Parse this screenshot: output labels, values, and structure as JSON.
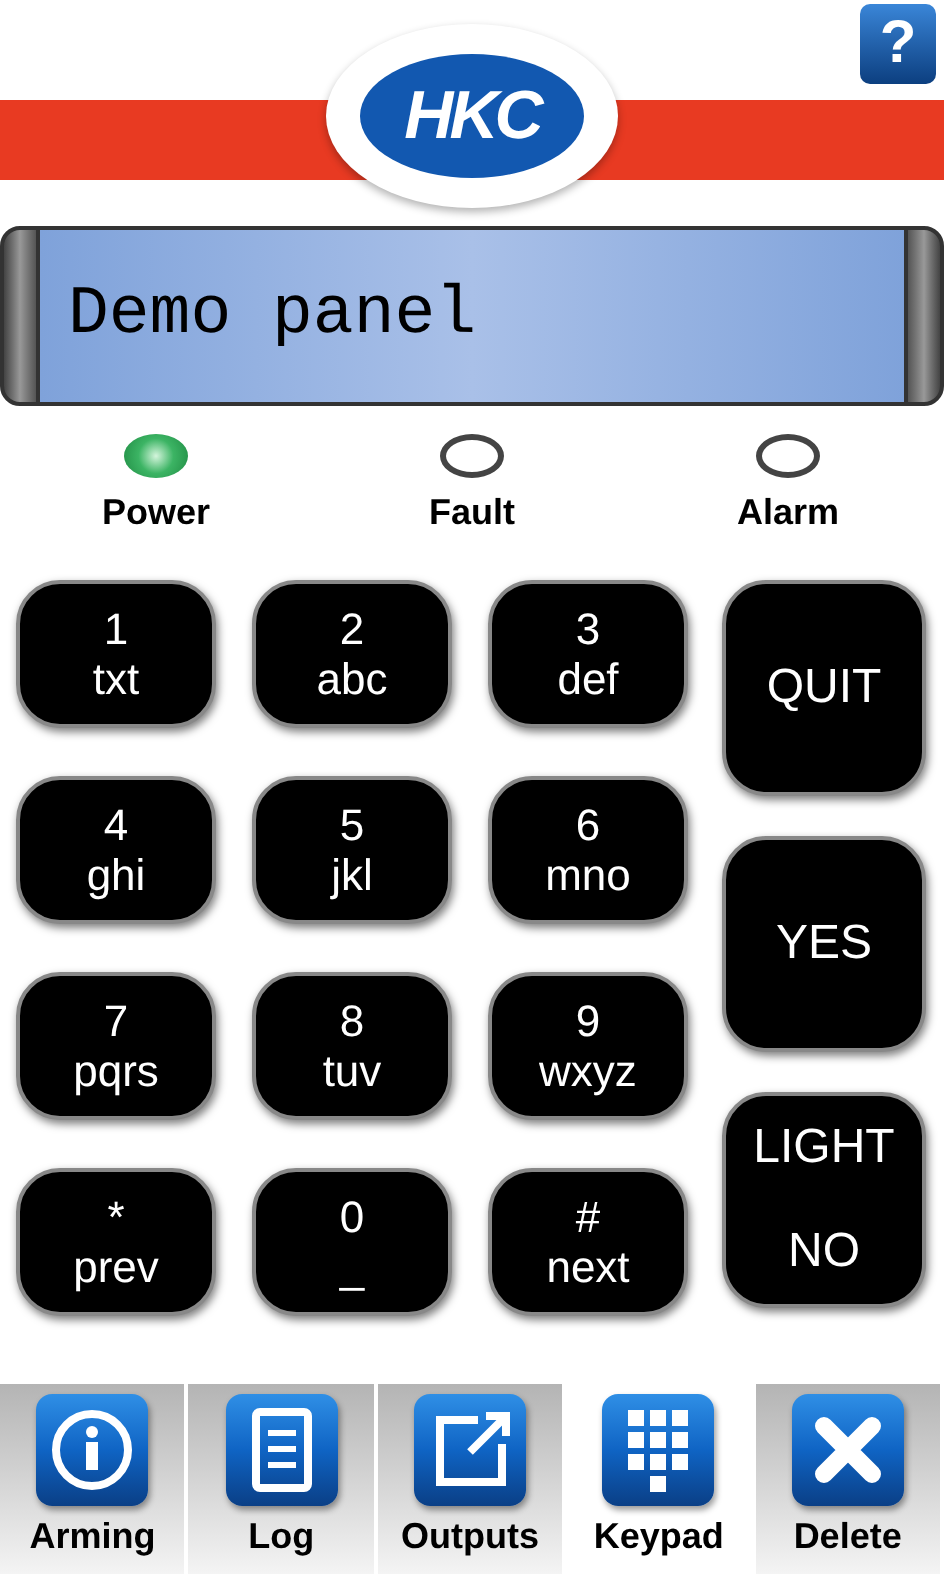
{
  "header": {
    "logo_text": "HKC",
    "help_label": "?"
  },
  "display": {
    "text": "Demo panel"
  },
  "leds": [
    {
      "label": "Power",
      "on": true
    },
    {
      "label": "Fault",
      "on": false
    },
    {
      "label": "Alarm",
      "on": false
    }
  ],
  "keys": [
    {
      "main": "1",
      "sub": "txt"
    },
    {
      "main": "2",
      "sub": "abc"
    },
    {
      "main": "3",
      "sub": "def"
    },
    {
      "main": "4",
      "sub": "ghi"
    },
    {
      "main": "5",
      "sub": "jkl"
    },
    {
      "main": "6",
      "sub": "mno"
    },
    {
      "main": "7",
      "sub": "pqrs"
    },
    {
      "main": "8",
      "sub": "tuv"
    },
    {
      "main": "9",
      "sub": "wxyz"
    },
    {
      "main": "*",
      "sub": "prev"
    },
    {
      "main": "0",
      "sub": "_"
    },
    {
      "main": "#",
      "sub": "next"
    }
  ],
  "side_keys": [
    {
      "lines": [
        "QUIT"
      ]
    },
    {
      "lines": [
        "YES"
      ]
    },
    {
      "lines": [
        "LIGHT",
        "NO"
      ]
    }
  ],
  "tabs": [
    {
      "label": "Arming",
      "kind": "info",
      "selected": false
    },
    {
      "label": "Log",
      "kind": "list",
      "selected": false
    },
    {
      "label": "Outputs",
      "kind": "external",
      "selected": false
    },
    {
      "label": "Keypad",
      "kind": "keypad",
      "selected": true
    },
    {
      "label": "Delete",
      "kind": "close",
      "selected": false
    }
  ]
}
